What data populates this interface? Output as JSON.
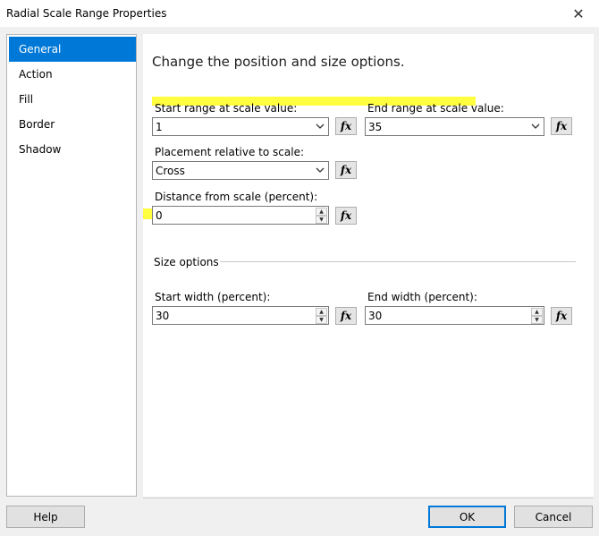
{
  "window": {
    "title": "Radial Scale Range Properties",
    "close_icon": "close-icon"
  },
  "sidebar": {
    "items": [
      {
        "label": "General",
        "active": true
      },
      {
        "label": "Action",
        "active": false
      },
      {
        "label": "Fill",
        "active": false
      },
      {
        "label": "Border",
        "active": false
      },
      {
        "label": "Shadow",
        "active": false
      }
    ]
  },
  "main": {
    "heading": "Change the position and size options.",
    "start_range": {
      "label": "Start range at scale value:",
      "value": "1"
    },
    "end_range": {
      "label": "End range at scale value:",
      "value": "35"
    },
    "placement": {
      "label": "Placement relative to scale:",
      "value": "Cross"
    },
    "distance": {
      "label": "Distance from scale (percent):",
      "value": "0"
    },
    "size_options": {
      "label": "Size options"
    },
    "start_width": {
      "label": "Start width (percent):",
      "value": "30"
    },
    "end_width": {
      "label": "End width (percent):",
      "value": "30"
    },
    "fx_label": "fx"
  },
  "footer": {
    "help": "Help",
    "ok": "OK",
    "cancel": "Cancel"
  },
  "colors": {
    "accent": "#0078d7",
    "highlight": "#ffff00"
  }
}
